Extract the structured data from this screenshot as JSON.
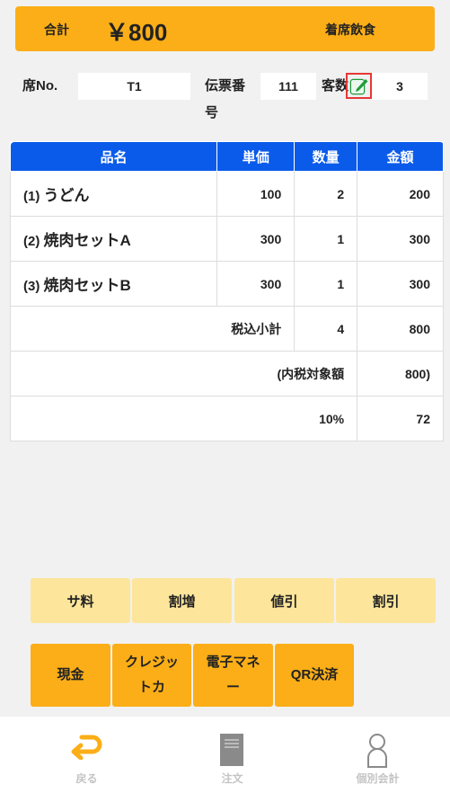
{
  "header": {
    "total_label": "合計",
    "total_amount": "￥800",
    "mode": "着席飲食"
  },
  "info": {
    "seat_label": "席No.",
    "seat_value": "T1",
    "slip_label_line1": "伝票番",
    "slip_label_line2": "号",
    "slip_value": "111",
    "guests_label": "客数",
    "guests_value": "3"
  },
  "table": {
    "headers": [
      "品名",
      "単価",
      "数量",
      "金額"
    ],
    "items": [
      {
        "no": "(1)",
        "name": "うどん",
        "price": "100",
        "qty": "2",
        "amount": "200"
      },
      {
        "no": "(2)",
        "name": "焼肉セットA",
        "price": "300",
        "qty": "1",
        "amount": "300"
      },
      {
        "no": "(3)",
        "name": "焼肉セットB",
        "price": "300",
        "qty": "1",
        "amount": "300"
      }
    ],
    "subtotal_label": "税込小計",
    "subtotal_qty": "4",
    "subtotal_amount": "800",
    "taxable_label": "(内税対象額",
    "taxable_amount": "800)",
    "tax_rate": "10%",
    "tax_amount": "72"
  },
  "adjust_buttons": [
    "サ料",
    "割増",
    "値引",
    "割引"
  ],
  "payment_buttons": [
    "現金",
    "クレジットカ",
    "電子マネー",
    "QR決済"
  ],
  "nav": {
    "back": "戻る",
    "order": "注文",
    "split": "個別会計"
  },
  "colors": {
    "accent": "#fbae17",
    "header_blue": "#0a5bea",
    "light_button": "#fde59b",
    "edit_highlight": "#e53935"
  }
}
